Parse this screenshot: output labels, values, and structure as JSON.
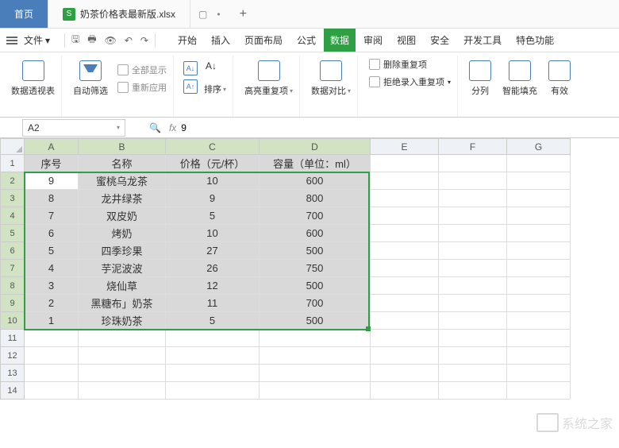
{
  "title_tabs": {
    "home": "首页",
    "doc_icon": "S",
    "doc_name": "奶茶价格表最新版.xlsx",
    "plus": "+"
  },
  "menu": {
    "file": "文件",
    "tabs": [
      "开始",
      "插入",
      "页面布局",
      "公式",
      "数据",
      "审阅",
      "视图",
      "安全",
      "开发工具",
      "特色功能"
    ],
    "active_index": 4
  },
  "ribbon": {
    "pivot": "数据透视表",
    "autofilter": "自动筛选",
    "show_all": "全部显示",
    "reapply": "重新应用",
    "sort_asc": "A↓",
    "sort_desc": "A↓",
    "sort": "排序",
    "highlight_dup": "高亮重复项",
    "data_compare": "数据对比",
    "remove_dup": "删除重复项",
    "reject_dup": "拒绝录入重复项",
    "split_col": "分列",
    "smart_fill": "智能填充",
    "validity": "有效"
  },
  "name_box": "A2",
  "formula_value": "9",
  "fx": "fx",
  "columns": [
    "A",
    "B",
    "C",
    "D",
    "E",
    "F",
    "G"
  ],
  "row_numbers": [
    1,
    2,
    3,
    4,
    5,
    6,
    7,
    8,
    9,
    10,
    11,
    12,
    13,
    14
  ],
  "headers": [
    "序号",
    "名称",
    "价格（元/杯）",
    "容量（单位：ml）"
  ],
  "rows": [
    [
      "9",
      "蜜桃乌龙茶",
      "10",
      "600"
    ],
    [
      "8",
      "龙井绿茶",
      "9",
      "800"
    ],
    [
      "7",
      "双皮奶",
      "5",
      "700"
    ],
    [
      "6",
      "烤奶",
      "10",
      "600"
    ],
    [
      "5",
      "四季珍果",
      "27",
      "500"
    ],
    [
      "4",
      "芋泥波波",
      "26",
      "750"
    ],
    [
      "3",
      "烧仙草",
      "12",
      "500"
    ],
    [
      "2",
      "黑糖布」奶茶",
      "11",
      "700"
    ],
    [
      "1",
      "珍珠奶茶",
      "5",
      "500"
    ]
  ],
  "watermark": "系统之家"
}
